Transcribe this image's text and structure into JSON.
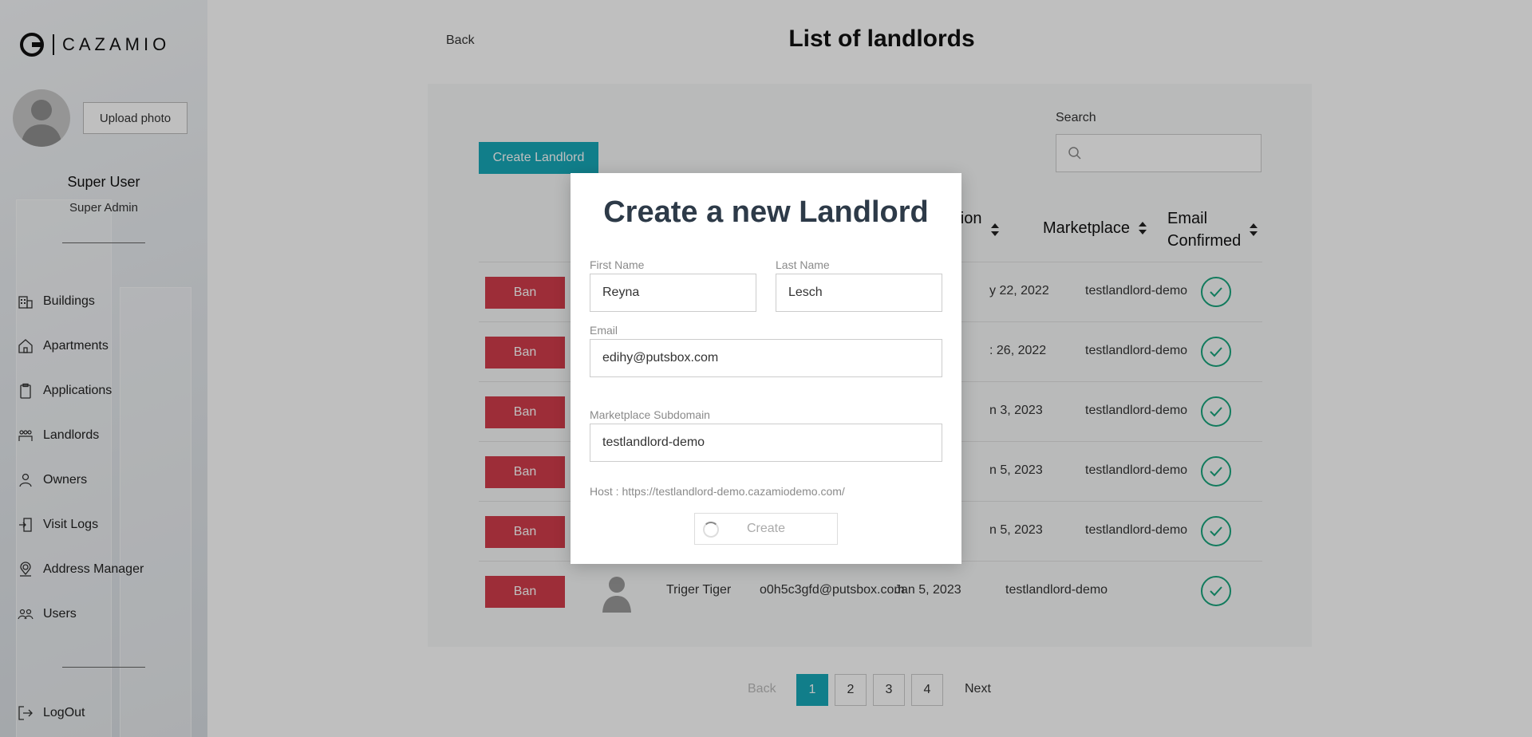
{
  "brand": {
    "name": "CAZAMIO"
  },
  "profile": {
    "upload_label": "Upload photo",
    "name": "Super User",
    "role": "Super Admin"
  },
  "nav": [
    {
      "label": "Buildings",
      "icon": "building-icon"
    },
    {
      "label": "Apartments",
      "icon": "home-icon"
    },
    {
      "label": "Applications",
      "icon": "clipboard-icon"
    },
    {
      "label": "Landlords",
      "icon": "people-group-icon"
    },
    {
      "label": "Owners",
      "icon": "owner-icon"
    },
    {
      "label": "Visit Logs",
      "icon": "door-icon"
    },
    {
      "label": "Address Manager",
      "icon": "location-pin-icon"
    },
    {
      "label": "Users",
      "icon": "users-icon"
    }
  ],
  "logout_label": "LogOut",
  "header": {
    "back": "Back",
    "title": "List of landlords"
  },
  "toolbar": {
    "create_label": "Create Landlord",
    "search_label": "Search",
    "search_value": ""
  },
  "table": {
    "columns": {
      "creation_date_partial": "eation\nte",
      "marketplace": "Marketplace",
      "email_confirmed": "Email\nConfirmed"
    },
    "ban_label": "Ban",
    "rows": [
      {
        "name": "",
        "email": "",
        "date": "y 22, 2022",
        "marketplace": "testlandlord-demo",
        "confirmed": true
      },
      {
        "name": "",
        "email": "",
        "date": ": 26, 2022",
        "marketplace": "testlandlord-demo",
        "confirmed": true
      },
      {
        "name": "",
        "email": "",
        "date": "n 3, 2023",
        "marketplace": "testlandlord-demo",
        "confirmed": true
      },
      {
        "name": "",
        "email": "",
        "date": "n 5, 2023",
        "marketplace": "testlandlord-demo",
        "confirmed": true
      },
      {
        "name": "",
        "email": "",
        "date": "n 5, 2023",
        "marketplace": "testlandlord-demo",
        "confirmed": true
      },
      {
        "name": "Triger Tiger",
        "email": "o0h5c3gfd@putsbox.com",
        "date": "Jan 5, 2023",
        "marketplace": "testlandlord-demo",
        "confirmed": true
      }
    ]
  },
  "pagination": {
    "back": "Back",
    "pages": [
      "1",
      "2",
      "3",
      "4"
    ],
    "current": "1",
    "next": "Next"
  },
  "modal": {
    "title": "Create a new Landlord",
    "first_name_label": "First Name",
    "first_name_value": "Reyna",
    "last_name_label": "Last Name",
    "last_name_value": "Lesch",
    "email_label": "Email",
    "email_value": "edihy@putsbox.com",
    "subdomain_label": "Marketplace Subdomain",
    "subdomain_value": "testlandlord-demo",
    "host_text": "Host : https://testlandlord-demo.cazamiodemo.com/",
    "create_label": "Create"
  },
  "colors": {
    "accent": "#17a9b9",
    "danger": "#d23d4b",
    "success": "#19a57d"
  }
}
